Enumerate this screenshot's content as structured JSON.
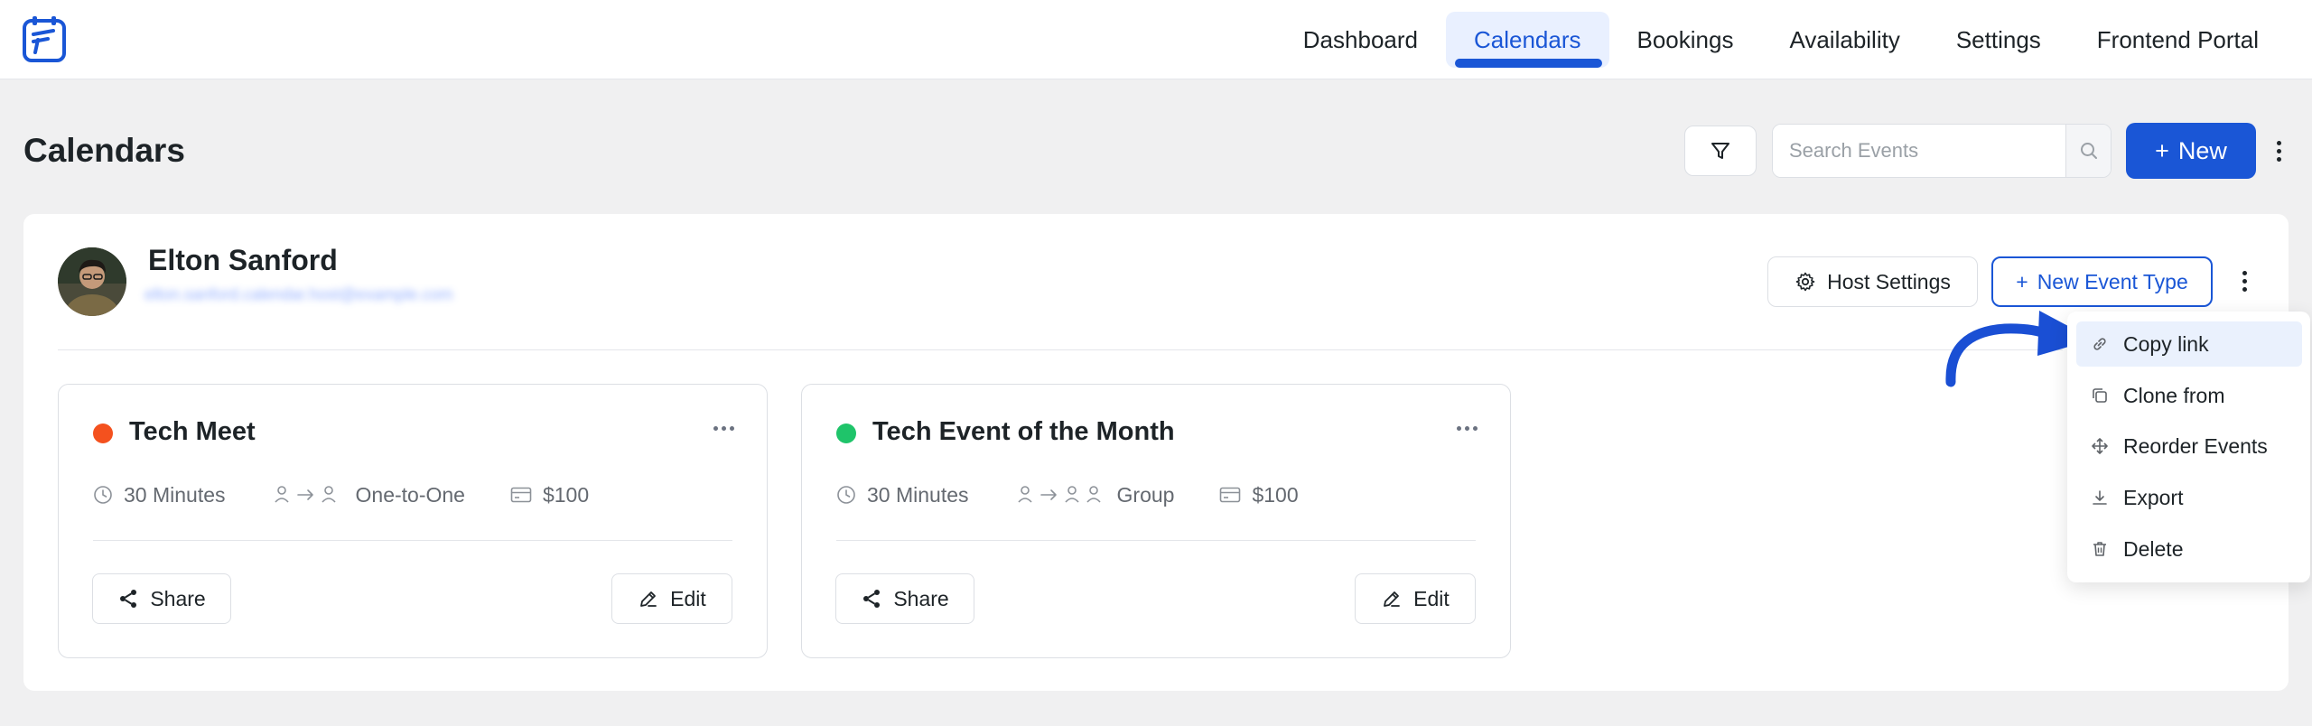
{
  "colors": {
    "accent": "#1a56d6",
    "tech_meet_dot": "#f4511e",
    "tech_event_dot": "#1fc46a",
    "highlight_row": "#eaf1fd",
    "annotation_arrow": "#1a4fd4"
  },
  "nav": {
    "items": [
      {
        "label": "Dashboard",
        "active": false
      },
      {
        "label": "Calendars",
        "active": true
      },
      {
        "label": "Bookings",
        "active": false
      },
      {
        "label": "Availability",
        "active": false
      },
      {
        "label": "Settings",
        "active": false
      },
      {
        "label": "Frontend Portal",
        "active": false
      }
    ]
  },
  "header": {
    "title": "Calendars",
    "search_placeholder": "Search Events",
    "new_label": "New",
    "icons": {
      "filter": "filter-icon",
      "search": "search-icon",
      "plus": "plus-icon",
      "more": "kebab-icon"
    }
  },
  "host": {
    "name": "Elton Sanford",
    "email_obscured": "elton.sanford.calendar.host@example.com",
    "host_settings_label": "Host Settings",
    "new_event_type_label": "New Event Type"
  },
  "events": [
    {
      "title": "Tech Meet",
      "duration": "30 Minutes",
      "type": "One-to-One",
      "price": "$100",
      "share_label": "Share",
      "edit_label": "Edit"
    },
    {
      "title": "Tech Event of the Month",
      "duration": "30 Minutes",
      "type": "Group",
      "price": "$100",
      "share_label": "Share",
      "edit_label": "Edit"
    }
  ],
  "dropdown": {
    "items": [
      {
        "label": "Copy link",
        "icon": "link-icon",
        "highlighted": true
      },
      {
        "label": "Clone from",
        "icon": "clone-icon",
        "highlighted": false
      },
      {
        "label": "Reorder Events",
        "icon": "move-icon",
        "highlighted": false
      },
      {
        "label": "Export",
        "icon": "download-icon",
        "highlighted": false
      },
      {
        "label": "Delete",
        "icon": "trash-icon",
        "highlighted": false
      }
    ]
  }
}
